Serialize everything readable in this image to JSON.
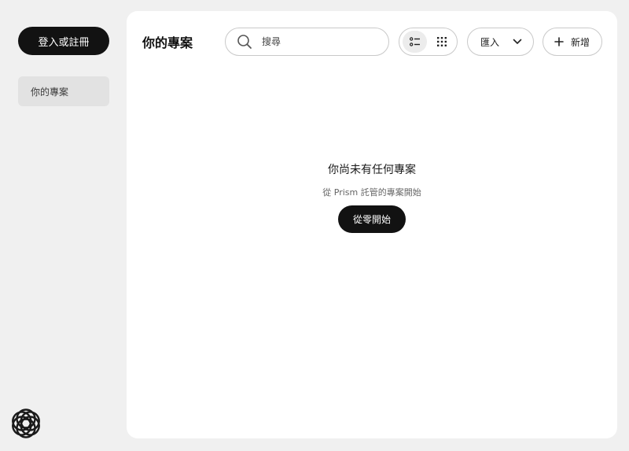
{
  "sidebar": {
    "login_label": "登入或註冊",
    "nav_items": [
      {
        "label": "你的專案",
        "active": true
      }
    ],
    "logo_icon": "flower-logo-icon"
  },
  "header": {
    "title": "你的專案",
    "search": {
      "placeholder": "搜尋",
      "value": ""
    },
    "view_modes": [
      "list-view-icon",
      "grid-view-icon"
    ],
    "active_view": "list",
    "import_label": "匯入",
    "new_label": "新增"
  },
  "empty_state": {
    "title": "你尚未有任何專案",
    "subtitle": "從 Prism 託管的專案開始",
    "action_label": "從零開始"
  },
  "colors": {
    "background": "#f0f0f0",
    "panel": "#ffffff",
    "primary_button": "#121212",
    "nav_active": "#e2e2e2",
    "border": "#c9c9c9"
  }
}
